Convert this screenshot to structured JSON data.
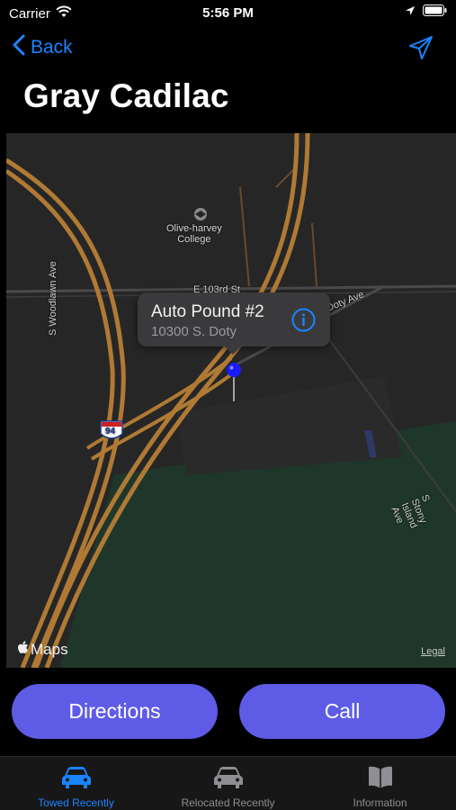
{
  "status_bar": {
    "carrier": "Carrier",
    "time": "5:56 PM",
    "icons": [
      "wifi-icon",
      "location-arrow-icon",
      "battery-icon"
    ]
  },
  "nav": {
    "back_label": "Back",
    "back_icon": "chevron-left-icon",
    "share_icon": "paper-plane-icon"
  },
  "title": "Gray Cadilac",
  "map": {
    "callout": {
      "name": "Auto Pound #2",
      "address": "10300 S. Doty",
      "icon": "info-icon"
    },
    "labels": {
      "college_line1": "Olive-harvey",
      "college_line2": "College",
      "street_103": "E 103rd St",
      "doty": "Doty Ave",
      "woodlawn": "S Woodlawn Ave",
      "stony": "S Stony Island Ave",
      "interstate": "94"
    },
    "logo": "Maps",
    "legal": "Legal",
    "colors": {
      "road": "#b07a34",
      "park": "#1f3a2c",
      "pin": "#1a1aff"
    }
  },
  "actions": {
    "directions": "Directions",
    "call": "Call",
    "color": "#5e5ce6"
  },
  "tabs": [
    {
      "label": "Towed Recently",
      "icon": "car-icon",
      "active": true
    },
    {
      "label": "Relocated Recently",
      "icon": "car-icon",
      "active": false
    },
    {
      "label": "Information",
      "icon": "book-icon",
      "active": false
    }
  ],
  "accent": "#1a84ff"
}
